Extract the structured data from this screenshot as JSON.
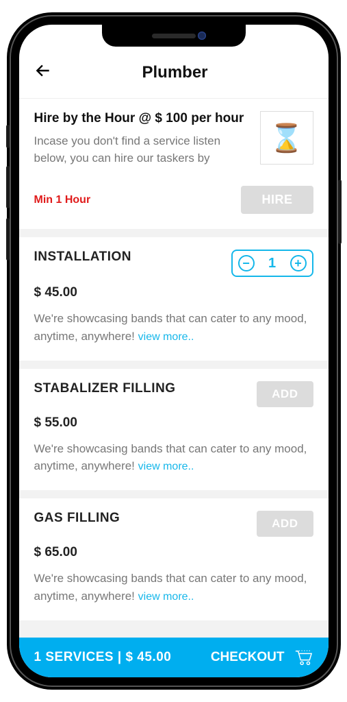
{
  "header": {
    "title": "Plumber"
  },
  "hire": {
    "title": "Hire by the Hour @ $ 100 per hour",
    "description": "Incase you don't find a service listen below, you can hire our taskers by",
    "min": "Min 1 Hour",
    "button": "HIRE"
  },
  "services": [
    {
      "name": "INSTALLATION",
      "price": "$ 45.00",
      "description": "We're showcasing bands that can cater to any mood, anytime, anywhere! ",
      "view_more": "view more..",
      "qty": "1",
      "has_stepper": true
    },
    {
      "name": "STABALIZER FILLING",
      "price": "$ 55.00",
      "description": "We're showcasing bands that can cater to any mood, anytime, anywhere! ",
      "view_more": "view more..",
      "add": "ADD",
      "has_stepper": false
    },
    {
      "name": "GAS FILLING",
      "price": "$ 65.00",
      "description": "We're showcasing bands that can cater to any mood, anytime, anywhere!  ",
      "view_more": "view more..",
      "add": "ADD",
      "has_stepper": false
    }
  ],
  "footer": {
    "summary": "1  SERVICES | $ 45.00",
    "checkout": "CHECKOUT"
  }
}
